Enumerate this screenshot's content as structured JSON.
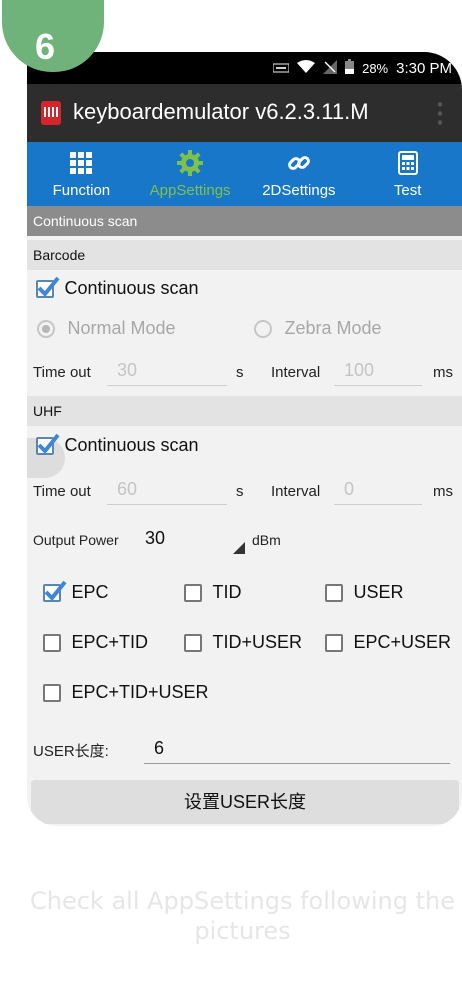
{
  "step": {
    "number": "6"
  },
  "statusbar": {
    "battery": "28%",
    "time": "3:30 PM"
  },
  "app": {
    "title": "keyboardemulator v6.2.3.11.M"
  },
  "tabs": [
    {
      "label": "Function",
      "icon": "grid-icon",
      "active": false
    },
    {
      "label": "AppSettings",
      "icon": "gear-icon",
      "active": true
    },
    {
      "label": "2DSettings",
      "icon": "link-icon",
      "active": false
    },
    {
      "label": "Test",
      "icon": "calculator-icon",
      "active": false
    }
  ],
  "continuous_scan_header": "Continuous scan",
  "barcode": {
    "header": "Barcode",
    "continuous_scan": {
      "label": "Continuous scan",
      "checked": true
    },
    "modes": [
      {
        "label": "Normal Mode",
        "selected": true
      },
      {
        "label": "Zebra Mode",
        "selected": false
      }
    ],
    "timeout_label": "Time out",
    "timeout_value": "30",
    "timeout_unit": "s",
    "interval_label": "Interval",
    "interval_value": "100",
    "interval_unit": "ms"
  },
  "uhf": {
    "header": "UHF",
    "continuous_scan": {
      "label": "Continuous scan",
      "checked": true
    },
    "timeout_label": "Time out",
    "timeout_value": "60",
    "timeout_unit": "s",
    "interval_label": "Interval",
    "interval_value": "0",
    "interval_unit": "ms",
    "output_power_label": "Output Power",
    "output_power_value": "30",
    "output_power_unit": "dBm",
    "options": [
      {
        "label": "EPC",
        "checked": true
      },
      {
        "label": "TID",
        "checked": false
      },
      {
        "label": "USER",
        "checked": false
      },
      {
        "label": "EPC+TID",
        "checked": false
      },
      {
        "label": "TID+USER",
        "checked": false
      },
      {
        "label": "EPC+USER",
        "checked": false
      },
      {
        "label": "EPC+TID+USER",
        "checked": false
      }
    ],
    "user_length_label": "USER长度:",
    "user_length_value": "6",
    "set_button": "设置USER长度"
  },
  "caption": "Check all AppSettings following the pictures",
  "colors": {
    "tab_bar": "#1877c9",
    "tab_active": "#7fc24a",
    "badge": "#6fb27a",
    "check": "#3f86d6"
  }
}
